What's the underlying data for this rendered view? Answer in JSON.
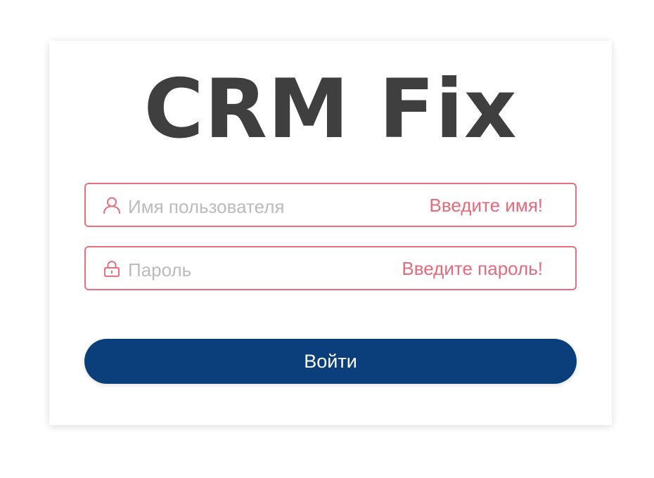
{
  "app": {
    "logo_text": "CRM Fix"
  },
  "login_form": {
    "username": {
      "icon": "user-icon",
      "placeholder": "Имя пользователя",
      "value": "",
      "error": "Введите имя!"
    },
    "password": {
      "icon": "lock-icon",
      "placeholder": "Пароль",
      "value": "",
      "error": "Введите пароль!"
    },
    "submit_label": "Войти"
  },
  "colors": {
    "logo_text": "#3f3f3f",
    "error": "#e8697a",
    "field_border_error": "#e8707d",
    "button_bg": "#0a3f7c",
    "button_text": "#ffffff",
    "placeholder": "#bbbbbb"
  }
}
